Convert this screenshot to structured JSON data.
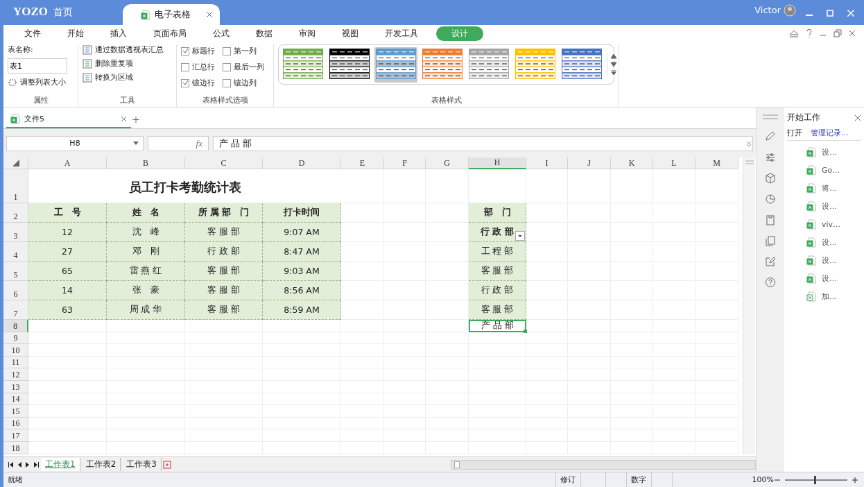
{
  "title_bar": {
    "logo": "YOZO",
    "home": "首页",
    "tabs": [
      {
        "label": "电子表格",
        "selected": true
      }
    ],
    "user": "Victor"
  },
  "menu": [
    {
      "label": "文件",
      "selected": false
    },
    {
      "label": "开始",
      "selected": false
    },
    {
      "label": "插入",
      "selected": false
    },
    {
      "label": "页面布局",
      "selected": false
    },
    {
      "label": "公式",
      "selected": false
    },
    {
      "label": "数据",
      "selected": false
    },
    {
      "label": "审阅",
      "selected": false
    },
    {
      "label": "视图",
      "selected": false
    },
    {
      "label": "开发工具",
      "selected": false
    },
    {
      "label": "设计",
      "selected": true
    }
  ],
  "ribbon": {
    "properties": {
      "name_label": "表名称:",
      "name_value": "表1",
      "resize": "调整列表大小",
      "caption": "属性"
    },
    "tools": {
      "items": [
        "通过数据透视表汇总",
        "删除重复项",
        "转换为区域"
      ],
      "caption": "工具"
    },
    "style_options": {
      "items": [
        {
          "label": "标题行",
          "checked": true
        },
        {
          "label": "第一列",
          "checked": false
        },
        {
          "label": "汇总行",
          "checked": false
        },
        {
          "label": "最后一列",
          "checked": false
        },
        {
          "label": "镶边行",
          "checked": true
        },
        {
          "label": "镶边列",
          "checked": false
        }
      ],
      "caption": "表格样式选项"
    },
    "styles": {
      "swatches": [
        {
          "color": "#70ad47",
          "selected": false
        },
        {
          "color": "#000000",
          "selected": false
        },
        {
          "color": "#5b9bd5",
          "selected": true
        },
        {
          "color": "#ed7d31",
          "selected": false
        },
        {
          "color": "#a5a5a5",
          "selected": false
        },
        {
          "color": "#ffc000",
          "selected": false
        },
        {
          "color": "#4472c4",
          "selected": false
        }
      ],
      "caption": "表格样式"
    }
  },
  "doc_tabs": [
    {
      "label": "文件5",
      "selected": true
    }
  ],
  "formula_bar": {
    "name_box": "H8",
    "fx": "fx",
    "value": "产 品 部"
  },
  "columns": [
    {
      "label": "A",
      "selected": false
    },
    {
      "label": "B",
      "selected": false
    },
    {
      "label": "C",
      "selected": false
    },
    {
      "label": "D",
      "selected": false
    },
    {
      "label": "E",
      "selected": false
    },
    {
      "label": "F",
      "selected": false
    },
    {
      "label": "G",
      "selected": false
    },
    {
      "label": "H",
      "selected": true
    },
    {
      "label": "I",
      "selected": false
    },
    {
      "label": "J",
      "selected": false
    },
    {
      "label": "K",
      "selected": false
    },
    {
      "label": "L",
      "selected": false
    },
    {
      "label": "M",
      "selected": false
    }
  ],
  "row_headers": [
    {
      "label": "1",
      "selected": false
    },
    {
      "label": "2",
      "selected": false
    },
    {
      "label": "3",
      "selected": false
    },
    {
      "label": "4",
      "selected": false
    },
    {
      "label": "5",
      "selected": false
    },
    {
      "label": "6",
      "selected": false
    },
    {
      "label": "7",
      "selected": false
    },
    {
      "label": "8",
      "selected": true
    },
    {
      "label": "9",
      "selected": false
    },
    {
      "label": "10",
      "selected": false
    },
    {
      "label": "11",
      "selected": false
    },
    {
      "label": "12",
      "selected": false
    },
    {
      "label": "13",
      "selected": false
    },
    {
      "label": "14",
      "selected": false
    },
    {
      "label": "15",
      "selected": false
    },
    {
      "label": "16",
      "selected": false
    },
    {
      "label": "17",
      "selected": false
    },
    {
      "label": "18",
      "selected": false
    }
  ],
  "sheet": {
    "title": "员工打卡考勤统计表",
    "table": {
      "columns": [
        "工　号",
        "姓　名",
        "所 属 部　门",
        "打卡时间"
      ],
      "rows": [
        [
          "12",
          "沈　峰",
          "客 服 部",
          "9:07 AM"
        ],
        [
          "27",
          "邓　刚",
          "行 政 部",
          "8:47 AM"
        ],
        [
          "65",
          "雷 燕 红",
          "客 服 部",
          "9:03 AM"
        ],
        [
          "14",
          "张　豪",
          "客 服 部",
          "8:56 AM"
        ],
        [
          "63",
          "周 成 华",
          "客 服 部",
          "8:59 AM"
        ]
      ]
    },
    "dept_list": {
      "header": "部　门",
      "items": [
        {
          "text": "行 政 部",
          "filter": true,
          "selected": false
        },
        {
          "text": "工 程 部",
          "filter": false,
          "selected": false
        },
        {
          "text": "客 服 部",
          "filter": false,
          "selected": false
        },
        {
          "text": "行 政 部",
          "filter": false,
          "selected": false
        },
        {
          "text": "客 服 部",
          "filter": false,
          "selected": false
        },
        {
          "text": "产 品 部",
          "filter": false,
          "selected": true
        }
      ]
    }
  },
  "sheet_tabs": [
    {
      "label": "工作表1",
      "selected": true
    },
    {
      "label": "工作表2",
      "selected": false
    },
    {
      "label": "工作表3",
      "selected": false
    }
  ],
  "side_panel": {
    "title": "开始工作",
    "open": "打开",
    "manage": "管理记录...",
    "files": [
      {
        "name": "设…",
        "kind": "sheet"
      },
      {
        "name": "Go…",
        "kind": "sheet"
      },
      {
        "name": "将…",
        "kind": "sheet"
      },
      {
        "name": "设…",
        "kind": "sheet"
      },
      {
        "name": "viv…",
        "kind": "sheet"
      },
      {
        "name": "设…",
        "kind": "sheet"
      },
      {
        "name": "设…",
        "kind": "sheet"
      },
      {
        "name": "设…",
        "kind": "sheet"
      },
      {
        "name": "加…",
        "kind": "template"
      }
    ]
  },
  "status_bar": {
    "status": "就绪",
    "revise": "修订",
    "numeric": "数字",
    "zoom": "100%",
    "zoom_slider": {
      "level": 0.48
    }
  }
}
